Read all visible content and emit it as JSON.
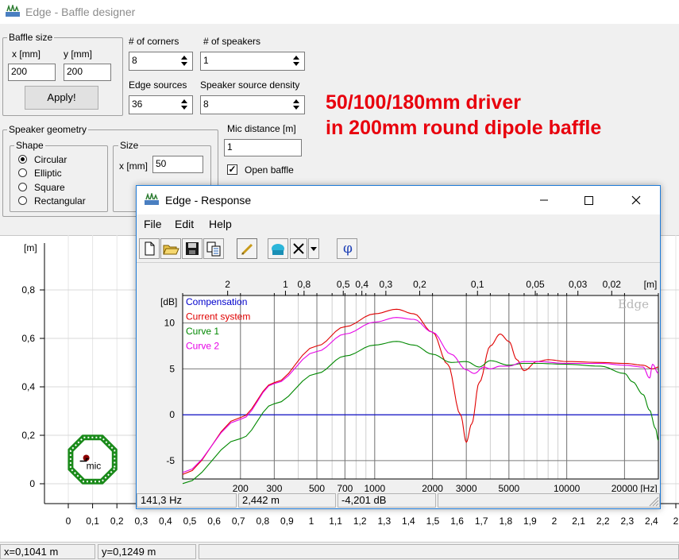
{
  "main_window": {
    "title": "Edge - Baffle designer",
    "baffle_size": {
      "group_label": "Baffle size",
      "x_label": "x [mm]",
      "x_value": "200",
      "y_label": "y [mm]",
      "y_value": "200",
      "apply_label": "Apply!"
    },
    "corners": {
      "label": "# of corners",
      "value": "8"
    },
    "speakers": {
      "label": "# of speakers",
      "value": "1"
    },
    "edge_sources": {
      "label": "Edge sources",
      "value": "36"
    },
    "speaker_source_density": {
      "label": "Speaker source density",
      "value": "8"
    },
    "speaker_geometry": {
      "group_label": "Speaker geometry",
      "shape_label": "Shape",
      "shapes": [
        "Circular",
        "Elliptic",
        "Square",
        "Rectangular"
      ],
      "selected_shape": "Circular",
      "size_label": "Size",
      "size_x_label": "x [mm]",
      "size_x_value": "50"
    },
    "mic_distance": {
      "label": "Mic distance [m]",
      "value": "1"
    },
    "open_baffle": {
      "label": "Open baffle",
      "checked": true
    },
    "geometry_plot": {
      "y_unit": "[m]",
      "y_ticks": [
        "0,8",
        "0,6",
        "0,4",
        "0,2",
        "0"
      ],
      "x_ticks": [
        "0",
        "0,1",
        "0,2",
        "0,3",
        "0,4",
        "0,5",
        "0,6",
        "0,7",
        "0,8",
        "0,9",
        "1",
        "1,1",
        "1,2",
        "1,3",
        "1,4",
        "1,5",
        "1,6",
        "1,7",
        "1,8",
        "1,9",
        "2",
        "2,1",
        "2,2",
        "2,3",
        "2,4",
        "2"
      ],
      "mic_label": "mic",
      "baffle_color": "#1a8a1a"
    },
    "status": {
      "x": "x=0,1041 m",
      "y": "y=0,1249 m"
    }
  },
  "annotation": {
    "line1": "50/100/180mm driver",
    "line2": "in 200mm round dipole baffle",
    "color": "#e8000d"
  },
  "response_window": {
    "title": "Edge - Response",
    "menu": [
      "File",
      "Edit",
      "Help"
    ],
    "toolbar_icons": [
      "new-file-icon",
      "open-folder-icon",
      "save-icon",
      "copy-icon",
      "pencil-icon",
      "speaker-icon",
      "delete-icon",
      "dropdown-arrow-icon",
      "phase-icon"
    ],
    "phase_symbol": "φ",
    "delete_symbol": "✕",
    "status": {
      "freq": "141,3 Hz",
      "wavelength": "2,442 m",
      "level": "-4,201 dB"
    }
  },
  "chart_data": {
    "type": "line",
    "title": "",
    "watermark": "Edge",
    "x_scale": "log",
    "xlabel": "[Hz]",
    "ylabel": "[dB]",
    "xlim": [
      100,
      30000
    ],
    "ylim": [
      -7,
      13
    ],
    "x_ticks": [
      200,
      300,
      500,
      700,
      1000,
      2000,
      3000,
      5000,
      10000,
      20000
    ],
    "y_ticks": [
      10,
      5,
      0,
      -5
    ],
    "top_axis_label": "[m]",
    "top_axis_ticks": [
      "2",
      "1",
      "0,8",
      "0,5",
      "0,4",
      "0,3",
      "0,2",
      "0,1",
      "0,05",
      "0,03",
      "0,02"
    ],
    "top_axis_values": [
      2,
      1,
      0.8,
      0.5,
      0.4,
      0.3,
      0.2,
      0.1,
      0.05,
      0.03,
      0.02
    ],
    "grid": true,
    "legend_placement": "top-left",
    "series": [
      {
        "name": "Compensation",
        "color": "#0000cc",
        "x": [
          100,
          30000
        ],
        "y": [
          0,
          0
        ]
      },
      {
        "name": "Current system",
        "color": "#e00000",
        "x": [
          100,
          200,
          300,
          500,
          700,
          1000,
          1300,
          1600,
          2000,
          2400,
          2800,
          3000,
          3200,
          3500,
          4000,
          4500,
          5000,
          5500,
          6000,
          7000,
          8000,
          10000,
          15000,
          20000,
          25000,
          28000,
          30000
        ],
        "y": [
          -6.5,
          -0.3,
          3.5,
          7.5,
          9.6,
          11.0,
          11.5,
          11.0,
          9.0,
          5.5,
          0.0,
          -3.0,
          -1.0,
          3.5,
          7.5,
          8.8,
          8.0,
          6.0,
          4.8,
          5.8,
          6.0,
          5.8,
          5.7,
          5.6,
          5.4,
          5.0,
          5.2
        ]
      },
      {
        "name": "Curve 1",
        "color": "#008800",
        "x": [
          100,
          200,
          300,
          500,
          700,
          1000,
          1300,
          1600,
          2000,
          2500,
          3000,
          3500,
          4000,
          5000,
          6000,
          7000,
          10000,
          15000,
          20000,
          22000,
          25000,
          27000,
          29000,
          30000
        ],
        "y": [
          -7.5,
          -2.6,
          1.2,
          4.5,
          6.4,
          7.6,
          8.0,
          7.6,
          6.6,
          5.7,
          5.8,
          5.2,
          5.9,
          5.4,
          5.6,
          5.6,
          5.5,
          5.3,
          4.5,
          3.6,
          2.2,
          0.5,
          -1.5,
          -2.8
        ]
      },
      {
        "name": "Curve 2",
        "color": "#e600e6",
        "x": [
          100,
          200,
          300,
          500,
          700,
          1000,
          1300,
          1600,
          2000,
          2500,
          3000,
          3300,
          3700,
          4000,
          4500,
          5000,
          6000,
          7000,
          10000,
          15000,
          20000,
          25000,
          27000,
          28000,
          30000
        ],
        "y": [
          -6.3,
          -0.5,
          3.4,
          6.9,
          8.8,
          10.1,
          10.6,
          10.4,
          9.0,
          6.6,
          4.9,
          4.5,
          5.2,
          5.0,
          5.3,
          5.3,
          5.8,
          5.8,
          5.6,
          5.6,
          5.4,
          5.2,
          4.0,
          5.5,
          4.5
        ]
      }
    ]
  }
}
